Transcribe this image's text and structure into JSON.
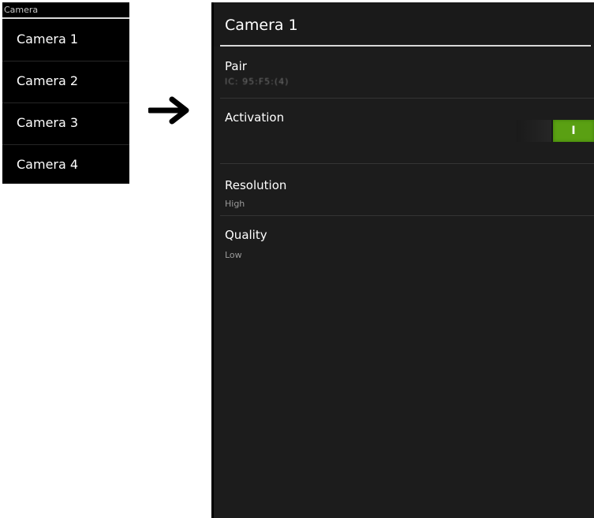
{
  "camera_list": {
    "header": "Camera",
    "items": [
      {
        "label": "Camera 1"
      },
      {
        "label": "Camera 2"
      },
      {
        "label": "Camera 3"
      },
      {
        "label": "Camera 4"
      }
    ]
  },
  "arrow_icon": "right-arrow-icon",
  "settings": {
    "title": "Camera 1",
    "pair": {
      "title": "Pair",
      "summary": "IC: 95:F5:(4)"
    },
    "activation": {
      "title": "Activation",
      "toggle_label": "I",
      "enabled": true,
      "toggle_color": "#5aa013"
    },
    "resolution": {
      "title": "Resolution",
      "summary": "High"
    },
    "quality": {
      "title": "Quality",
      "summary": "Low"
    }
  }
}
